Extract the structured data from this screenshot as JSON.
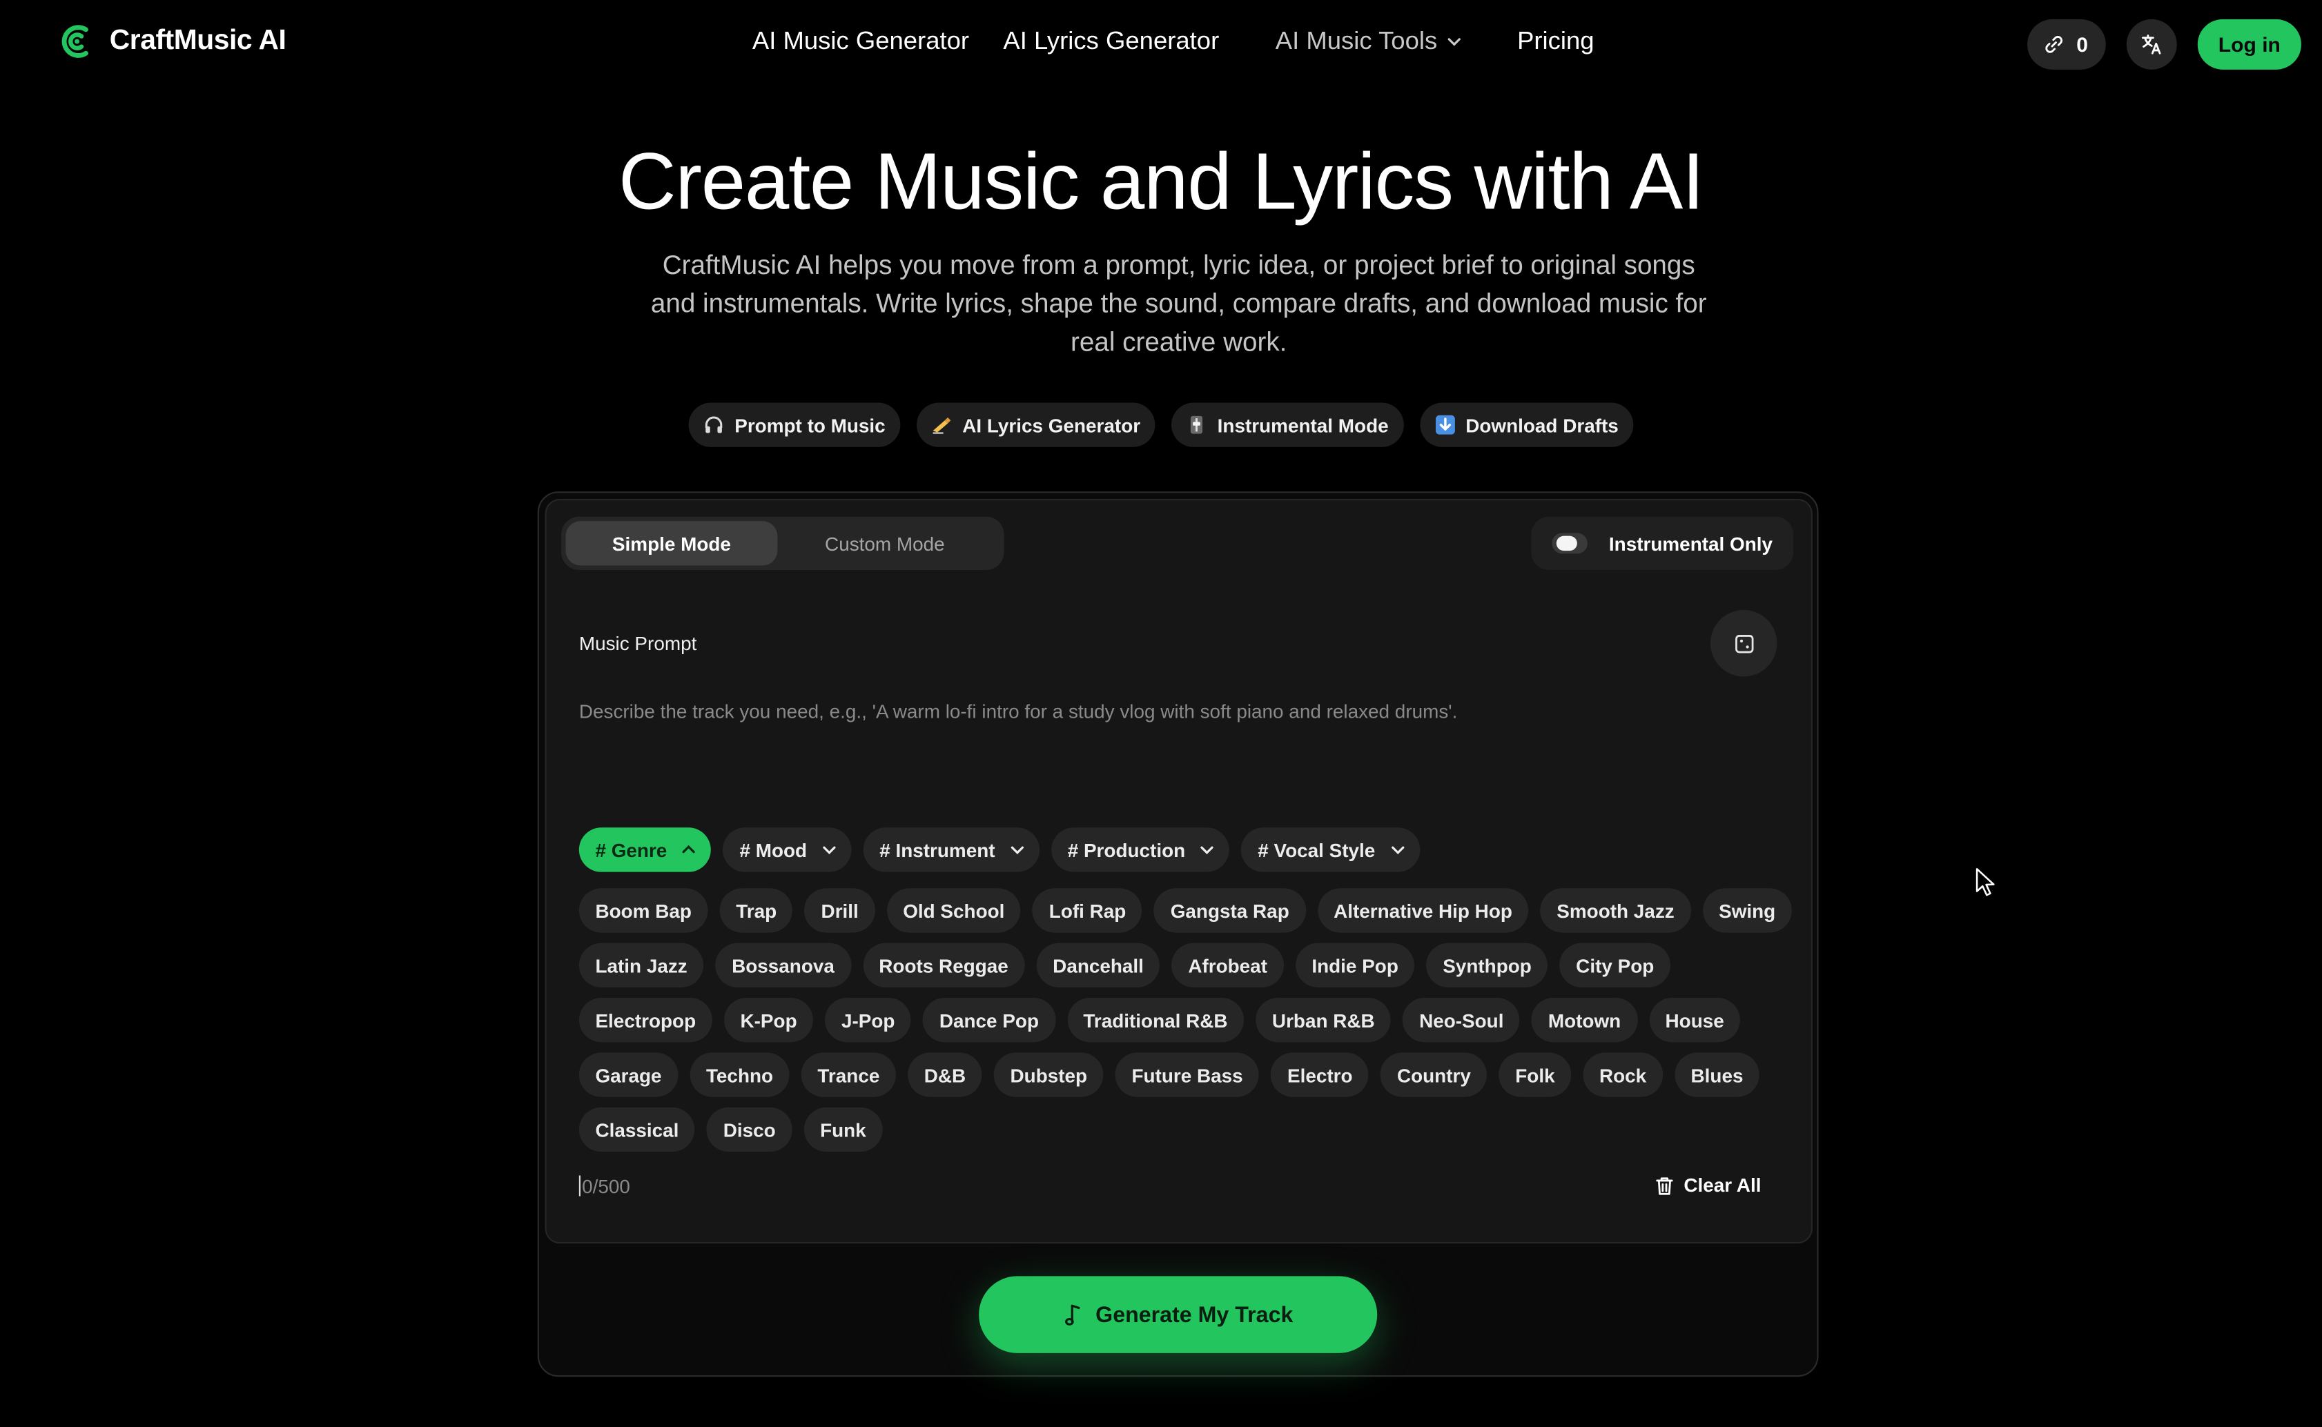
{
  "brand": {
    "name": "CraftMusic AI"
  },
  "nav": {
    "items": [
      "AI Music Generator",
      "AI Lyrics Generator",
      "AI Music Tools",
      "Pricing"
    ]
  },
  "header": {
    "credits": "0",
    "login_label": "Log in"
  },
  "hero": {
    "title": "Create Music and Lyrics with AI",
    "subtitle": "CraftMusic AI helps you move from a prompt, lyric idea, or project brief to original songs and instrumentals. Write lyrics, shape the sound, compare drafts, and download music for real creative work."
  },
  "features": [
    {
      "icon": "headphones-icon",
      "label": "Prompt to Music"
    },
    {
      "icon": "writing-hand-icon",
      "label": "AI Lyrics Generator"
    },
    {
      "icon": "slider-icon",
      "label": "Instrumental Mode"
    },
    {
      "icon": "download-arrow-icon",
      "label": "Download Drafts"
    }
  ],
  "modes": {
    "simple": "Simple Mode",
    "custom": "Custom Mode",
    "active": "simple"
  },
  "instrumental": {
    "label": "Instrumental Only",
    "on": false
  },
  "prompt": {
    "label": "Music Prompt",
    "placeholder": "Describe the track you need, e.g., 'A warm lo-fi intro for a study vlog with soft piano and relaxed drums'.",
    "value": ""
  },
  "categories": [
    {
      "label": "# Genre",
      "active": true
    },
    {
      "label": "# Mood",
      "active": false
    },
    {
      "label": "# Instrument",
      "active": false
    },
    {
      "label": "# Production",
      "active": false
    },
    {
      "label": "# Vocal Style",
      "active": false
    }
  ],
  "genre_tags": [
    [
      "Boom Bap",
      "Trap",
      "Drill",
      "Old School",
      "Lofi Rap",
      "Gangsta Rap",
      "Alternative Hip Hop",
      "Smooth Jazz",
      "Swing"
    ],
    [
      "Latin Jazz",
      "Bossanova",
      "Roots Reggae",
      "Dancehall",
      "Afrobeat",
      "Indie Pop",
      "Synthpop",
      "City Pop"
    ],
    [
      "Electropop",
      "K-Pop",
      "J-Pop",
      "Dance Pop",
      "Traditional R&B",
      "Urban R&B",
      "Neo-Soul",
      "Motown",
      "House"
    ],
    [
      "Garage",
      "Techno",
      "Trance",
      "D&B",
      "Dubstep",
      "Future Bass",
      "Electro",
      "Country",
      "Folk",
      "Rock",
      "Blues"
    ],
    [
      "Classical",
      "Disco",
      "Funk"
    ]
  ],
  "counter": "0/500",
  "clear_label": "Clear All",
  "generate_label": "Generate My Track",
  "colors": {
    "accent": "#22c55e",
    "background": "#000000",
    "card": "#161616",
    "chip": "#262626"
  }
}
